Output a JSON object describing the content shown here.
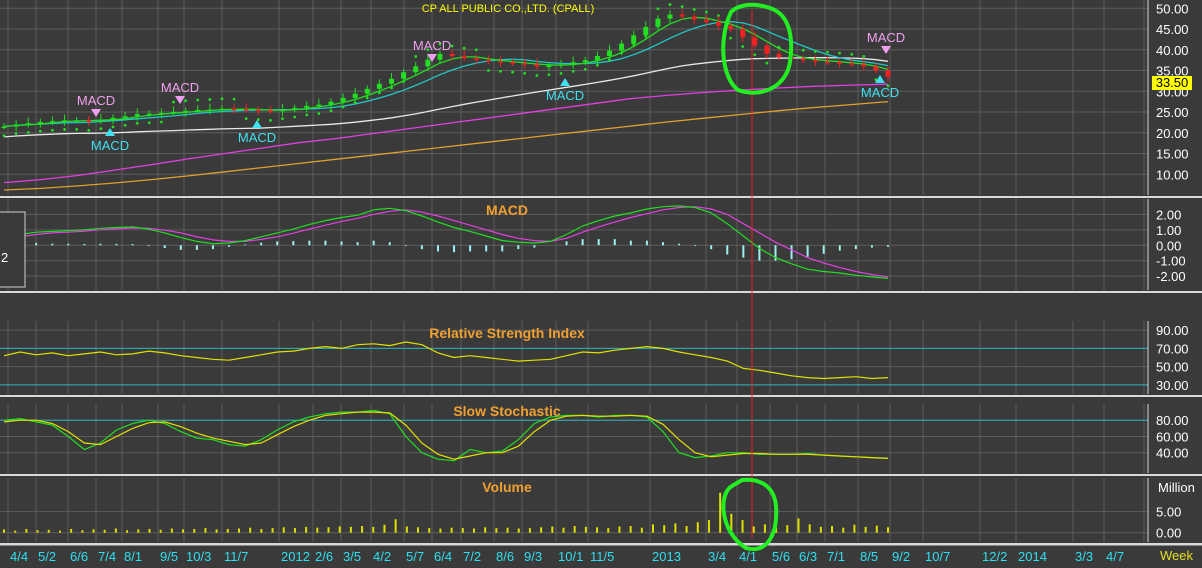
{
  "chart_title": "CP ALL PUBLIC CO.,LTD. (CPALL)",
  "last_price": "33.50",
  "left_stub_label": "2",
  "volume_unit": "Million",
  "period_label": "Week",
  "colors": {
    "background": "#3a3a3a",
    "grid": "#5c5c5c",
    "panel_title": "#f0a030",
    "axis_text": "#ffffff",
    "date_text": "#2ee0f0",
    "candle_up": "#22dd22",
    "candle_down": "#ee2222",
    "sma10": "#22dd22",
    "sma20": "#20c8c8",
    "sma50": "#e8e8e8",
    "sma100": "#e040e0",
    "sma200": "#e0a030",
    "parabolic_sar": "#22dd22",
    "macd_line": "#22dd22",
    "macd_signal": "#e040e0",
    "macd_hist": "#a0f0f0",
    "rsi": "#e0e000",
    "stoch_k": "#22dd22",
    "stoch_d": "#e0e000",
    "volume": "#e0e000",
    "highlight": "#22ee22",
    "event_line": "#ee2222",
    "buy_signal": "#40e0f0",
    "sell_signal": "#f0a0f0"
  },
  "x_axis": {
    "labels": [
      "4/4",
      "5/2",
      "6/6",
      "7/4",
      "8/1",
      "9/5",
      "10/3",
      "11/7",
      "2012",
      "2/6",
      "3/5",
      "4/2",
      "5/7",
      "6/4",
      "7/2",
      "8/6",
      "9/3",
      "10/1",
      "11/5",
      "2013",
      "3/4",
      "4/1",
      "5/6",
      "6/3",
      "7/1",
      "8/5",
      "9/2",
      "10/7",
      "12/2",
      "2014",
      "3/3",
      "4/7"
    ]
  },
  "signals": {
    "sell_label": "MACD",
    "buy_label": "MACD"
  },
  "chart_data": [
    {
      "type": "candlestick",
      "title": "",
      "ylim": [
        5,
        52
      ],
      "yticks": [
        10,
        15,
        20,
        25,
        30,
        35,
        40,
        45,
        50
      ],
      "close_approx": [
        21.5,
        22,
        22.3,
        22.6,
        22.8,
        23,
        23,
        22.8,
        23.2,
        23.6,
        24,
        24.5,
        24.6,
        24.8,
        25,
        25.3,
        25.5,
        25.6,
        25.8,
        25.7,
        25.6,
        25.4,
        25.2,
        25.6,
        26,
        26.5,
        26.8,
        27.5,
        28.4,
        29.4,
        30.6,
        31.8,
        33,
        34.6,
        36,
        37.6,
        39,
        38.5,
        38,
        37.6,
        37.2,
        37,
        36.8,
        36.5,
        36,
        36.2,
        36.5,
        37,
        37.5,
        38.5,
        39.8,
        41.5,
        43.5,
        45.5,
        47.5,
        48.5,
        48,
        47.3,
        46.7,
        45.8,
        45,
        43,
        41,
        39,
        38.2,
        37.8,
        37.5,
        37.2,
        37,
        36.8,
        36.5,
        36,
        35,
        33.5
      ],
      "sma100_approx": [
        8,
        8.7,
        9.7,
        11,
        12.3,
        13.7,
        15,
        16.3,
        17.6,
        18.6,
        19.8,
        21,
        22.2,
        23.4,
        24.6,
        25.8,
        27,
        28.2,
        29,
        29.7,
        30.3,
        30.8,
        31.2,
        31.5,
        31.7
      ],
      "sma200_approx": [
        6.2,
        6.6,
        7.2,
        7.9,
        8.7,
        9.6,
        10.6,
        11.6,
        12.6,
        13.6,
        14.6,
        15.6,
        16.6,
        17.6,
        18.6,
        19.6,
        20.6,
        21.6,
        22.6,
        23.5,
        24.4,
        25.3,
        26.1,
        26.8,
        27.5
      ]
    },
    {
      "type": "line",
      "title": "MACD",
      "ylim": [
        -2.9,
        3.0
      ],
      "yticks": [
        -2.0,
        -1.0,
        0.0,
        1.0,
        2.0
      ],
      "series": [
        {
          "name": "",
          "values": [
            0.45,
            0.7,
            0.85,
            0.9,
            0.95,
            1.0,
            1.1,
            1.15,
            1.2,
            1.05,
            0.8,
            0.5,
            0.25,
            0.1,
            0.15,
            0.3,
            0.55,
            0.8,
            1.05,
            1.35,
            1.6,
            1.8,
            1.95,
            2.3,
            2.4,
            2.25,
            1.9,
            1.5,
            1.15,
            0.9,
            0.6,
            0.3,
            0.2,
            0.15,
            0.25,
            0.7,
            1.25,
            1.6,
            1.9,
            2.1,
            2.35,
            2.5,
            2.55,
            2.45,
            2.1,
            1.4,
            0.6,
            -0.2,
            -0.8,
            -1.2,
            -1.55,
            -1.7,
            -1.8,
            -1.95,
            -2.05,
            -2.15
          ]
        },
        {
          "name": "",
          "values": [
            0.4,
            0.55,
            0.7,
            0.8,
            0.85,
            0.92,
            1.0,
            1.06,
            1.12,
            1.1,
            0.98,
            0.8,
            0.55,
            0.35,
            0.25,
            0.25,
            0.38,
            0.55,
            0.78,
            1.05,
            1.3,
            1.55,
            1.75,
            2.0,
            2.2,
            2.3,
            2.15,
            1.9,
            1.6,
            1.3,
            1.0,
            0.7,
            0.45,
            0.3,
            0.25,
            0.45,
            0.85,
            1.2,
            1.5,
            1.8,
            2.05,
            2.3,
            2.45,
            2.5,
            2.35,
            2.0,
            1.4,
            0.8,
            0.2,
            -0.3,
            -0.8,
            -1.15,
            -1.45,
            -1.7,
            -1.9,
            -2.05
          ]
        }
      ]
    },
    {
      "type": "line",
      "title": "Relative Strength Index",
      "ylim": [
        20,
        100
      ],
      "yticks": [
        30.0,
        50.0,
        70.0,
        90.0
      ],
      "series": [
        {
          "name": "",
          "values": [
            62,
            66,
            63,
            65,
            62,
            64,
            66,
            63,
            64,
            67,
            65,
            62,
            60,
            58,
            57,
            60,
            63,
            66,
            67,
            70,
            72,
            70,
            74,
            75,
            73,
            77,
            74,
            65,
            60,
            62,
            60,
            58,
            56,
            57,
            58,
            62,
            66,
            65,
            68,
            70,
            72,
            70,
            66,
            63,
            60,
            56,
            48,
            46,
            43,
            40,
            38,
            37,
            38,
            39,
            37,
            38
          ]
        }
      ]
    },
    {
      "type": "line",
      "title": "Slow Stochastic",
      "ylim": [
        15,
        100
      ],
      "yticks": [
        40.0,
        60.0,
        80.0
      ],
      "series": [
        {
          "name": "",
          "values": [
            80,
            82,
            78,
            74,
            60,
            44,
            52,
            68,
            76,
            80,
            76,
            66,
            58,
            56,
            50,
            48,
            56,
            68,
            78,
            84,
            88,
            90,
            90,
            92,
            88,
            60,
            40,
            32,
            30,
            44,
            40,
            42,
            56,
            76,
            84,
            86,
            86,
            84,
            86,
            86,
            84,
            66,
            40,
            34,
            36,
            40,
            40,
            38,
            38,
            38,
            39,
            37,
            36,
            35,
            34,
            33
          ]
        },
        {
          "name": "",
          "values": [
            78,
            80,
            80,
            76,
            66,
            52,
            50,
            60,
            70,
            77,
            78,
            72,
            64,
            58,
            54,
            50,
            52,
            62,
            72,
            80,
            86,
            88,
            90,
            90,
            89,
            74,
            52,
            38,
            32,
            36,
            40,
            40,
            48,
            66,
            80,
            85,
            86,
            85,
            85,
            86,
            85,
            75,
            56,
            40,
            35,
            37,
            39,
            39,
            38,
            38,
            38,
            37,
            36,
            35,
            34,
            33
          ]
        }
      ]
    },
    {
      "type": "bar",
      "title": "Volume",
      "ylim": [
        -2.2,
        13
      ],
      "yticks": [
        0.0,
        5.0
      ],
      "values": [
        0.8,
        0.5,
        0.9,
        0.6,
        0.7,
        0.5,
        0.9,
        0.6,
        0.8,
        0.7,
        1.0,
        0.6,
        0.8,
        0.9,
        0.7,
        1.0,
        0.8,
        0.9,
        1.1,
        0.8,
        0.9,
        1.0,
        1.2,
        0.9,
        1.1,
        1.3,
        1.1,
        1.4,
        1.2,
        1.3,
        1.5,
        1.4,
        1.6,
        1.4,
        1.9,
        3.2,
        1.5,
        1.3,
        1.1,
        1.0,
        1.2,
        1.1,
        1.0,
        1.3,
        1.1,
        1.2,
        1.0,
        1.1,
        1.3,
        1.5,
        1.2,
        1.6,
        1.4,
        1.3,
        1.1,
        1.5,
        1.6,
        1.2,
        2.0,
        1.8,
        2.2,
        1.6,
        2.5,
        3.0,
        9.5,
        4.5,
        3.0,
        1.5,
        2.0,
        1.3,
        1.8,
        3.4,
        2.0,
        1.4,
        1.6,
        1.2,
        1.9,
        1.4,
        1.7,
        1.3
      ]
    }
  ]
}
